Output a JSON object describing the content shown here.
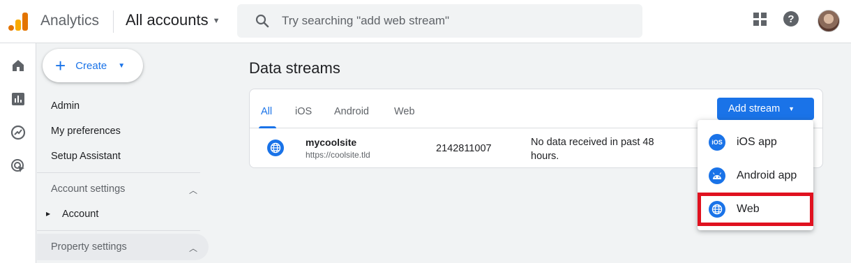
{
  "header": {
    "brand": "Analytics",
    "account_selector": "All accounts",
    "search_placeholder": "Try searching \"add web stream\""
  },
  "nav": {
    "create_label": "Create",
    "items": [
      "Admin",
      "My preferences",
      "Setup Assistant"
    ],
    "account_settings": "Account settings",
    "account_item": "Account",
    "property_settings": "Property settings"
  },
  "page": {
    "title": "Data streams",
    "tabs": [
      "All",
      "iOS",
      "Android",
      "Web"
    ],
    "active_tab": "All",
    "add_stream_label": "Add stream"
  },
  "streams": [
    {
      "name": "mycoolsite",
      "url": "https://coolsite.tld",
      "id": "2142811007",
      "status": "No data received in past 48 hours."
    }
  ],
  "add_stream_menu": {
    "items": [
      "iOS app",
      "Android app",
      "Web"
    ],
    "ios_badge": "iOS",
    "highlighted": "Web"
  },
  "colors": {
    "accent": "#1a73e8",
    "highlight": "#e0111f",
    "logo": [
      "#f9ab00",
      "#e37400",
      "#e37400"
    ]
  }
}
